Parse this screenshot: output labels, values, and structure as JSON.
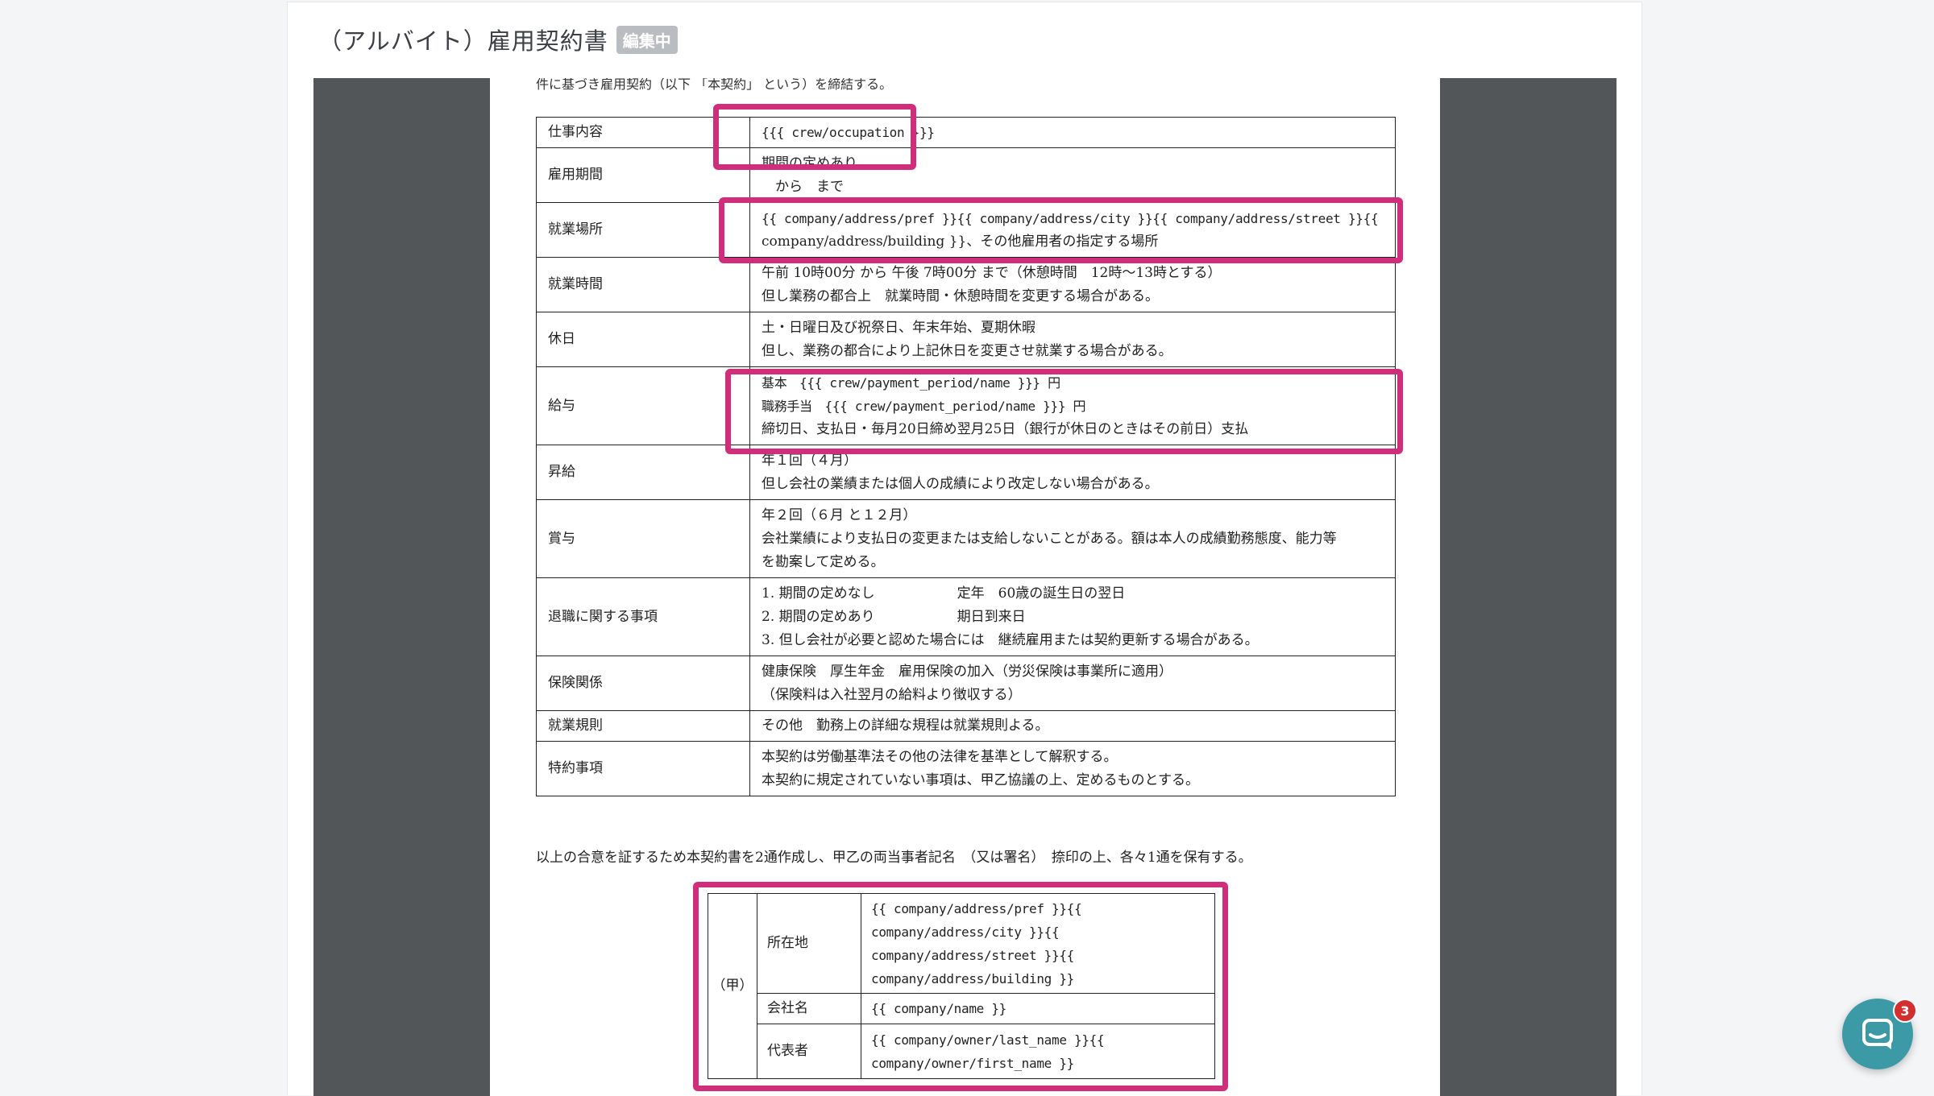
{
  "header": {
    "title": "（アルバイト）雇用契約書",
    "badge": "編集中"
  },
  "document": {
    "intro": "件に基づき雇用契約（以下 「本契約」 という）を締結する。",
    "rows": [
      {
        "label": "仕事内容",
        "lines": [
          "{{{ crew/occupation }}}"
        ]
      },
      {
        "label": "雇用期間",
        "lines": [
          "期間の定めあり",
          "　から　まで"
        ]
      },
      {
        "label": "就業場所",
        "lines": [
          "{{ company/address/pref }}{{ company/address/city }}{{ company/address/street }}{{",
          "company/address/building }}、その他雇用者の指定する場所"
        ]
      },
      {
        "label": "就業時間",
        "lines": [
          "午前 10時00分 から 午後 7時00分 まで（休憩時間　12時～13時とする）",
          "但し業務の都合上　就業時間・休憩時間を変更する場合がある。"
        ]
      },
      {
        "label": "休日",
        "lines": [
          "土・日曜日及び祝祭日、年末年始、夏期休暇",
          "但し、業務の都合により上記休日を変更させ就業する場合がある。"
        ]
      },
      {
        "label": "給与",
        "lines": [
          "基本　{{{ crew/payment_period/name }}} 円",
          "職務手当　{{{ crew/payment_period/name }}} 円",
          "締切日、支払日・毎月20日締め翌月25日（銀行が休日のときはその前日）支払"
        ]
      },
      {
        "label": "昇給",
        "lines": [
          "年１回（４月）",
          "但し会社の業績または個人の成績により改定しない場合がある。"
        ]
      },
      {
        "label": "賞与",
        "lines": [
          "年２回（６月 と１２月）",
          "会社業績により支払日の変更または支給しないことがある。額は本人の成績勤務態度、能力等",
          "を勘案して定める。"
        ]
      },
      {
        "label": "退職に関する事項",
        "lines": [
          "1. 期間の定めなし　　　　　　定年　60歳の誕生日の翌日",
          "2. 期間の定めあり　　　　　　期日到来日",
          "3. 但し会社が必要と認めた場合には　継続雇用または契約更新する場合がある。"
        ]
      },
      {
        "label": "保険関係",
        "lines": [
          "健康保険　厚生年金　雇用保険の加入（労災保険は事業所に適用）",
          "（保険料は入社翌月の給料より徴収する）"
        ]
      },
      {
        "label": "就業規則",
        "lines": [
          "その他　勤務上の詳細な規程は就業規則よる。"
        ]
      },
      {
        "label": "特約事項",
        "lines": [
          "本契約は労働基準法その他の法律を基準として解釈する。",
          "本契約に規定されていない事項は、甲乙協議の上、定めるものとする。"
        ]
      }
    ],
    "closing": "以上の合意を証するため本契約書を2通作成し、甲乙の両当事者記名　（又は署名）　捺印の上、各々1通を保有する。",
    "party": {
      "key": "（甲）",
      "rows": [
        {
          "label": "所在地",
          "lines": [
            "{{ company/address/pref }}{{",
            "company/address/city }}{{",
            "company/address/street }}{{",
            "company/address/building }}"
          ]
        },
        {
          "label": "会社名",
          "lines": [
            "{{ company/name }}"
          ]
        },
        {
          "label": "代表者",
          "lines": [
            "{{ company/owner/last_name }}{{",
            "company/owner/first_name }}"
          ]
        }
      ]
    }
  },
  "chat": {
    "count": "3",
    "icon": "chat-bubble-icon"
  },
  "colors": {
    "highlight": "#d02e7a",
    "viewer_bg": "#525659",
    "chat": "#3c9aa6",
    "badge_bg": "#b9bcc1"
  }
}
